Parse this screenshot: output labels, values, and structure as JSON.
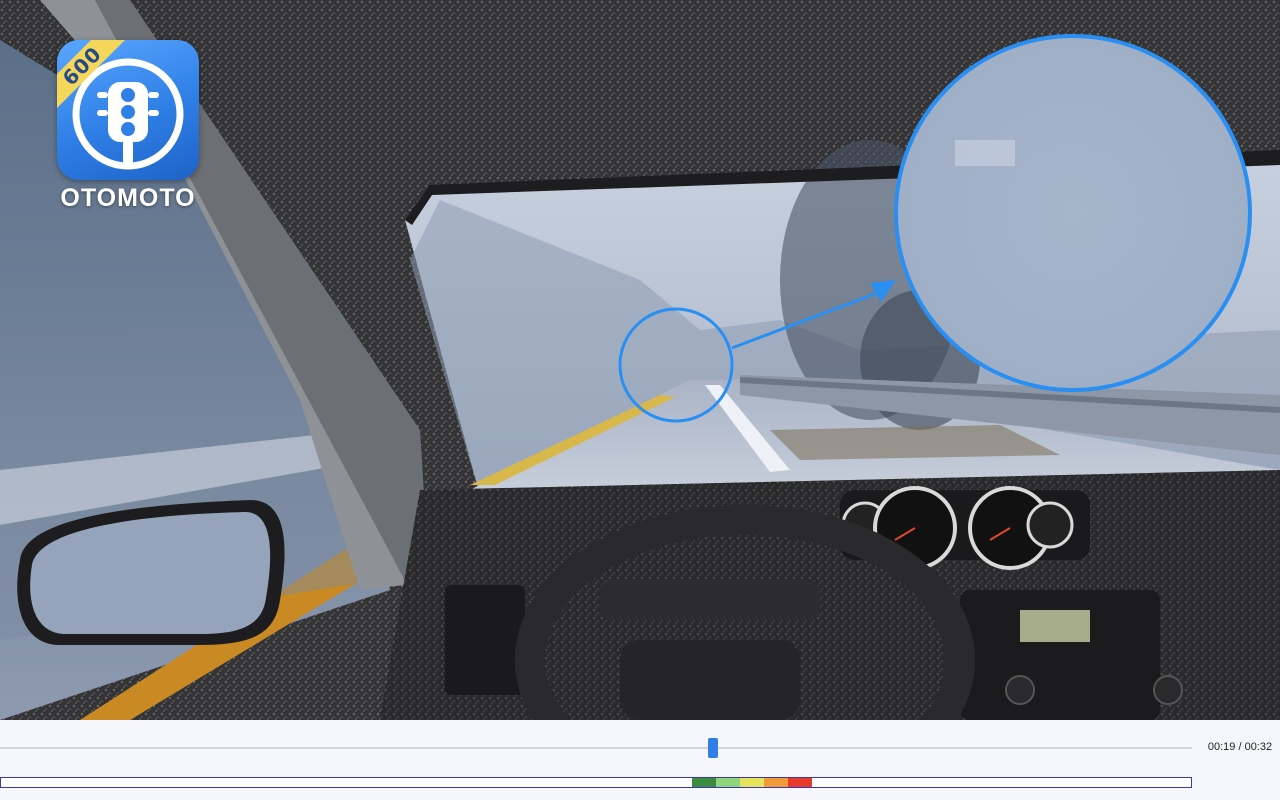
{
  "app": {
    "brand_name": "OTOMOTO",
    "badge_number": "600"
  },
  "scene": {
    "description_icon": "traffic-light-icon",
    "callout_color": "#2a8ff2"
  },
  "player": {
    "time_display": "00:19 / 00:32",
    "progress_fraction": 0.594,
    "accent_color": "#2f7fe6",
    "hazard_segments": [
      {
        "color": "#3d8c3d"
      },
      {
        "color": "#8fd67a"
      },
      {
        "color": "#e6e35c"
      },
      {
        "color": "#f09a3a"
      },
      {
        "color": "#e83a2a"
      }
    ]
  }
}
